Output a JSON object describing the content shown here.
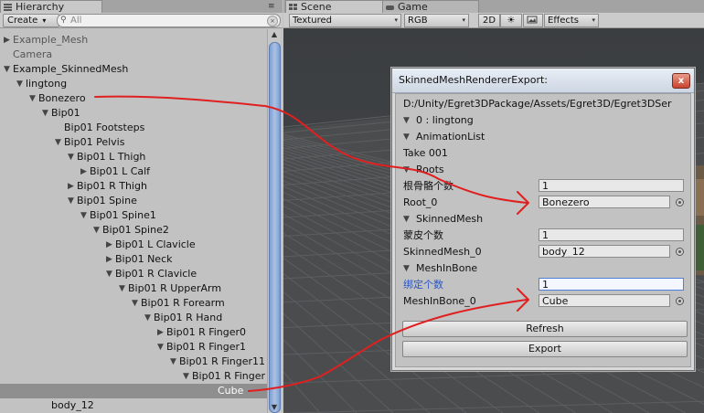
{
  "hierarchy": {
    "tab_label": "Hierarchy",
    "create_label": "Create",
    "create_caret": "▾",
    "search_placeholder": "All",
    "tree": [
      {
        "label": "Example_Mesh",
        "depth": 0,
        "arrow": "closed",
        "gray": true
      },
      {
        "label": "Camera",
        "depth": 0,
        "arrow": "none",
        "gray": true
      },
      {
        "label": "Example_SkinnedMesh",
        "depth": 0,
        "arrow": "open",
        "gray": false
      },
      {
        "label": "lingtong",
        "depth": 1,
        "arrow": "open",
        "gray": false
      },
      {
        "label": "Bonezero",
        "depth": 2,
        "arrow": "open",
        "gray": false
      },
      {
        "label": "Bip01",
        "depth": 3,
        "arrow": "open",
        "gray": false
      },
      {
        "label": "Bip01 Footsteps",
        "depth": 4,
        "arrow": "none",
        "gray": false
      },
      {
        "label": "Bip01 Pelvis",
        "depth": 4,
        "arrow": "open",
        "gray": false
      },
      {
        "label": "Bip01 L Thigh",
        "depth": 5,
        "arrow": "open",
        "gray": false
      },
      {
        "label": "Bip01 L Calf",
        "depth": 6,
        "arrow": "closed",
        "gray": false
      },
      {
        "label": "Bip01 R Thigh",
        "depth": 5,
        "arrow": "closed",
        "gray": false
      },
      {
        "label": "Bip01 Spine",
        "depth": 5,
        "arrow": "open",
        "gray": false
      },
      {
        "label": "Bip01 Spine1",
        "depth": 6,
        "arrow": "open",
        "gray": false
      },
      {
        "label": "Bip01 Spine2",
        "depth": 7,
        "arrow": "open",
        "gray": false
      },
      {
        "label": "Bip01 L Clavicle",
        "depth": 8,
        "arrow": "closed",
        "gray": false
      },
      {
        "label": "Bip01 Neck",
        "depth": 8,
        "arrow": "closed",
        "gray": false
      },
      {
        "label": "Bip01 R Clavicle",
        "depth": 8,
        "arrow": "open",
        "gray": false
      },
      {
        "label": "Bip01 R UpperArm",
        "depth": 9,
        "arrow": "open",
        "gray": false
      },
      {
        "label": "Bip01 R Forearm",
        "depth": 10,
        "arrow": "open",
        "gray": false
      },
      {
        "label": "Bip01 R Hand",
        "depth": 11,
        "arrow": "open",
        "gray": false
      },
      {
        "label": "Bip01 R Finger0",
        "depth": 12,
        "arrow": "closed",
        "gray": false
      },
      {
        "label": "Bip01 R Finger1",
        "depth": 12,
        "arrow": "open",
        "gray": false
      },
      {
        "label": "Bip01 R Finger11",
        "depth": 13,
        "arrow": "open",
        "gray": false
      },
      {
        "label": "Bip01 R Finger",
        "depth": 14,
        "arrow": "open",
        "gray": false
      },
      {
        "label": "Cube",
        "depth": 16,
        "arrow": "none",
        "gray": false,
        "selected": true
      },
      {
        "label": "body_12",
        "depth": 3,
        "arrow": "none",
        "gray": false
      }
    ]
  },
  "scene": {
    "tab_scene": "Scene",
    "tab_game": "Game",
    "shading_mode": "Textured",
    "render_mode": "RGB",
    "toggle_2d": "2D",
    "light_icon": "sun-icon",
    "effects_label": "Effects"
  },
  "dialog": {
    "title": "SkinnedMeshRendererExport:",
    "path": "D:/Unity/Egret3DPackage/Assets/Egret3D/Egret3DSer",
    "node_label": "0 : lingtong",
    "animation_list_label": "AnimationList",
    "take_label": "Take 001",
    "roots_label": "Roots",
    "root_count_label": "根骨骼个数",
    "root_count_value": "1",
    "root0_label": "Root_0",
    "root0_value": "Bonezero",
    "skinned_mesh_label": "SkinnedMesh",
    "skin_count_label": "蒙皮个数",
    "skin_count_value": "1",
    "skinned_mesh0_label": "SkinnedMesh_0",
    "skinned_mesh0_value": "body_12",
    "mesh_in_bone_label": "MeshInBone",
    "bind_count_label": "绑定个数",
    "bind_count_value": "1",
    "mesh_in_bone0_label": "MeshInBone_0",
    "mesh_in_bone0_value": "Cube",
    "refresh_label": "Refresh",
    "export_label": "Export",
    "close_glyph": "x"
  },
  "colors": {
    "annotation": "#e02020",
    "selection": "#8f8f8f",
    "scroll_thumb": "#8fabd9",
    "focus": "#4f7fd8"
  }
}
